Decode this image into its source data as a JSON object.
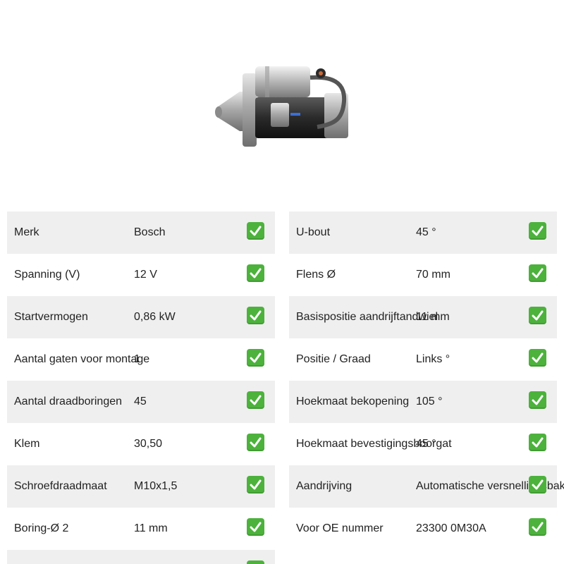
{
  "left_specs": [
    {
      "label": "Merk",
      "value": "Bosch",
      "icon": "check-mark-icon"
    },
    {
      "label": "Spanning (V)",
      "value": "12 V",
      "icon": "check-mark-icon"
    },
    {
      "label": "Startvermogen",
      "value": "0,86 kW",
      "icon": "check-mark-icon"
    },
    {
      "label": "Aantal gaten voor montage",
      "value": "1",
      "icon": "check-mark-icon"
    },
    {
      "label": "Aantal draadboringen",
      "value": "45",
      "icon": "check-mark-icon"
    },
    {
      "label": "Klem",
      "value": "30,50",
      "icon": "check-mark-icon"
    },
    {
      "label": "Schroefdraadmaat",
      "value": "M10x1,5",
      "icon": "check-mark-icon"
    },
    {
      "label": "Boring-Ø 2",
      "value": "11 mm",
      "icon": "check-mark-icon"
    },
    {
      "label": "",
      "value": "",
      "icon": "check-mark-icon"
    }
  ],
  "right_specs": [
    {
      "label": "U-bout",
      "value": "45 °",
      "icon": "check-mark-icon"
    },
    {
      "label": "Flens Ø",
      "value": "70 mm",
      "icon": "check-mark-icon"
    },
    {
      "label": "Basispositie aandrijftandwiel",
      "value": "11 mm",
      "icon": "check-mark-icon"
    },
    {
      "label": "Positie / Graad",
      "value": "Links °",
      "icon": "check-mark-icon"
    },
    {
      "label": "Hoekmaat bekopening",
      "value": "105 °",
      "icon": "check-mark-icon"
    },
    {
      "label": "Hoekmaat bevestigingsboorgat",
      "value": "45 °",
      "icon": "check-mark-icon"
    },
    {
      "label": "Aandrijving",
      "value": "Automatische versnellingsbak",
      "icon": "check-mark-icon"
    },
    {
      "label": "Voor OE nummer",
      "value": "23300 0M30A",
      "icon": "check-mark-icon"
    }
  ],
  "colors": {
    "row_shade": "#efefef",
    "check_green": "#4cb23c",
    "text": "#222222"
  }
}
